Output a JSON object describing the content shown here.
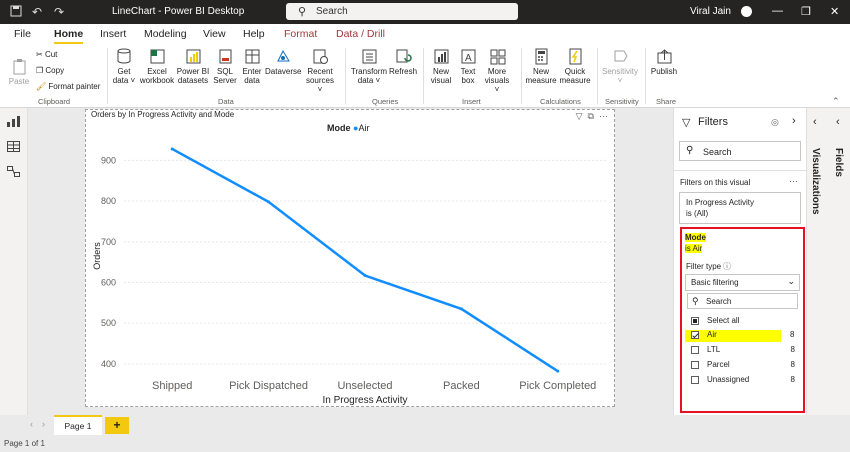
{
  "window": {
    "title": "LineChart - Power BI Desktop",
    "search_placeholder": "Search",
    "user": "Viral Jain"
  },
  "menu": {
    "tabs": [
      {
        "label": "File"
      },
      {
        "label": "Home"
      },
      {
        "label": "Insert"
      },
      {
        "label": "Modeling"
      },
      {
        "label": "View"
      },
      {
        "label": "Help"
      },
      {
        "label": "Format"
      },
      {
        "label": "Data / Drill"
      }
    ],
    "active": "Home"
  },
  "ribbon": {
    "clipboard": {
      "paste": "Paste",
      "cut": "Cut",
      "copy": "Copy",
      "format_painter": "Format painter",
      "label": "Clipboard"
    },
    "data": {
      "get_data": [
        "Get",
        "data ˅"
      ],
      "excel": [
        "Excel",
        "workbook"
      ],
      "pbi_datasets": [
        "Power BI",
        "datasets"
      ],
      "sql": [
        "SQL",
        "Server"
      ],
      "enter_data": [
        "Enter",
        "data"
      ],
      "dataverse": [
        "Dataverse",
        ""
      ],
      "recent": [
        "Recent",
        "sources ˅"
      ],
      "label": "Data"
    },
    "queries": {
      "transform": [
        "Transform",
        "data ˅"
      ],
      "refresh": [
        "Refresh",
        ""
      ],
      "label": "Queries"
    },
    "insert": {
      "new_visual": [
        "New",
        "visual"
      ],
      "text_box": [
        "Text",
        "box"
      ],
      "more_visuals": [
        "More",
        "visuals ˅"
      ],
      "label": "Insert"
    },
    "calculations": {
      "new_measure": [
        "New",
        "measure"
      ],
      "quick_measure": [
        "Quick",
        "measure"
      ],
      "label": "Calculations"
    },
    "sensitivity": {
      "btn": [
        "Sensitivity",
        "˅"
      ],
      "label": "Sensitivity"
    },
    "share": {
      "publish": [
        "Publish",
        ""
      ],
      "label": "Share"
    }
  },
  "visual": {
    "title": "Orders by In Progress Activity and Mode",
    "legend_title": "Mode",
    "legend_item": "Air",
    "line_color": "#118dff"
  },
  "chart_data": {
    "type": "line",
    "categories": [
      "Shipped",
      "Pick Dispatched",
      "Unselected",
      "Packed",
      "Pick Completed"
    ],
    "series": [
      {
        "name": "Air",
        "values": [
          928,
          798,
          617,
          535,
          382
        ]
      }
    ],
    "xlabel": "In Progress Activity",
    "ylabel": "Orders",
    "yticks": [
      400,
      500,
      600,
      700,
      800,
      900
    ],
    "ylim": [
      380,
      950
    ],
    "grid": true,
    "legend": "top-center"
  },
  "filters": {
    "title": "Filters",
    "search_placeholder": "Search",
    "section": "Filters on this visual",
    "card1": {
      "name": "In Progress Activity",
      "value": "is (All)"
    },
    "card2": {
      "name": "Mode",
      "value": "is Air",
      "filter_type_label": "Filter type",
      "filter_type": "Basic filtering",
      "search_placeholder": "Search",
      "select_all": "Select all",
      "items": [
        {
          "label": "Air",
          "count": "8",
          "checked": true
        },
        {
          "label": "LTL",
          "count": "8",
          "checked": false
        },
        {
          "label": "Parcel",
          "count": "8",
          "checked": false
        },
        {
          "label": "Unassigned",
          "count": "8",
          "checked": false
        }
      ]
    }
  },
  "side": {
    "visualizations": "Visualizations",
    "fields": "Fields"
  },
  "pages": {
    "tab": "Page 1",
    "status": "Page 1 of 1"
  }
}
